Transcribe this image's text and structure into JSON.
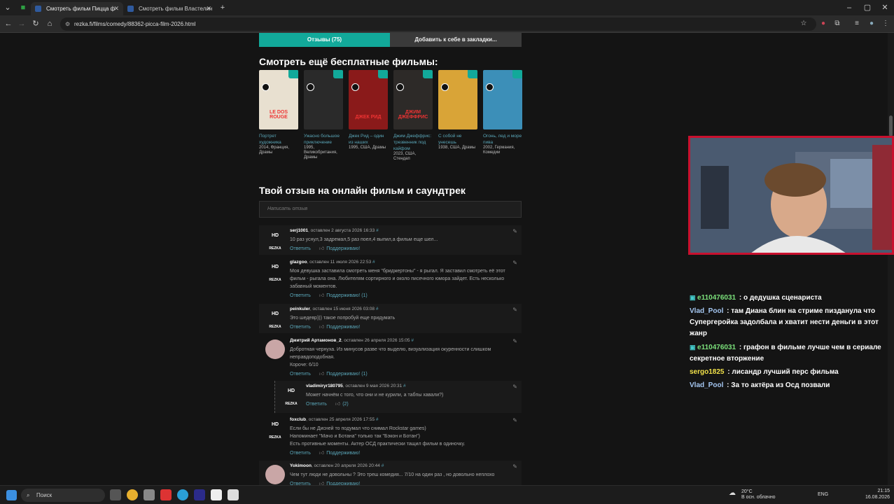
{
  "browser": {
    "tabs": [
      {
        "label": "Смотреть фильм Пицца ф"
      },
      {
        "label": "Смотреть фильм Властелин"
      }
    ],
    "url": "rezka.fi/films/comedy/88362-picca-film-2026.html"
  },
  "page": {
    "reviews_button": "Отзывы (75)",
    "bookmark_button": "Добавить к себе в закладки...",
    "more_title": "Смотреть ещё бесплатные фильмы:",
    "films": [
      {
        "title": "Портрет художника",
        "meta": "2014, Франция, Драмы",
        "poster_text": "LE DOS ROUGE",
        "color": "#e8e0d0"
      },
      {
        "title": "Ужасно большое приключение",
        "meta": "1995, Великобритания, Драмы",
        "poster_text": "",
        "color": "#2a2a2a"
      },
      {
        "title": "Джек Рид – один из наших",
        "meta": "1995, США, Драмы",
        "poster_text": "ДЖЕК РИД",
        "color": "#8a1a1a"
      },
      {
        "title": "Джим Джеффрис: трезвенник под кайфом",
        "meta": "2023, США, Стендап",
        "poster_text": "ДЖИМ ДЖЕФФРИС",
        "color": "#2d2a28"
      },
      {
        "title": "С собой не унесешь",
        "meta": "1938, США, Драмы",
        "poster_text": "",
        "color": "#d9a437"
      },
      {
        "title": "Огонь, лед и море пива",
        "meta": "2002, Германия, Комедии",
        "poster_text": "",
        "color": "#3c8fb8"
      }
    ],
    "review_title": "Твой отзыв на онлайн фильм и саундтрек",
    "comment_placeholder": "Написать отзыв",
    "comments": [
      {
        "user": "serj1001",
        "date": ", оставлен 2 августа 2026 16:33",
        "text": "10 раз уснул,3 задремал,5 раз поел,4 выпил,а фильм еще шел...",
        "reply": "Ответить",
        "like": "Поддерживаю!"
      },
      {
        "user": "glazgoo",
        "date": ", оставлен 11 июля 2026 22:53",
        "text": "Моя девушка заставила смотреть меня \"бриджертоны\" - я рыгал. Я заставил смотреть её этот фильм - рыгала она. Любителям сортирного и около писечного юмора зайдет. Есть несколько забавный моментов.",
        "reply": "Ответить",
        "like": "Поддерживаю! (1)"
      },
      {
        "user": "peinkuler",
        "date": ", оставлен 15 июня 2026 03:08",
        "text": "Это шедевр))) такое попробуй еще придумать",
        "reply": "Ответить",
        "like": "Поддерживаю!"
      },
      {
        "user": "Дмитрий Артамонов_2",
        "date": ", оставлен 26 апреля 2026 15:05",
        "text": "Добротная чернуха. Из минусов разве что выделю, визуализация окуренности слишком неправдоподобная.",
        "text2": "Короче: 6/10",
        "reply": "Ответить",
        "like": "Поддерживаю! (1)"
      },
      {
        "user": "vladimiryr180795",
        "date": ", оставлен 9 мая 2026 20:31",
        "text": "Может начнём с того, что они и не курили, а табпы хавали?)",
        "reply": "Ответить",
        "like": "(2)"
      },
      {
        "user": "foxclub",
        "date": ", оставлен 25 апреля 2026 17:55",
        "text": "Если бы не Дисней то подумал что снимал Rockstar games)",
        "text2": "Напоминает \"Мачо и Ботана\" только так \"Бэкон и Ботан\")",
        "text3": "Есть противные моменты. Актер ОСД практически тащил фильм в одиночку.",
        "reply": "Ответить",
        "like": "Поддерживаю!"
      },
      {
        "user": "Yokimoon",
        "date": ", оставлен 20 апреля 2026 20:44",
        "text": "Чем тут люди не довольны ? Это треш комедия... 7/10 на один раз , но довольно неплохо",
        "reply": "Ответить",
        "like": "Поддерживаю!"
      }
    ],
    "hd_label": "HD",
    "brand": "REZKA"
  },
  "chat": [
    {
      "user": "e110476031",
      "text": " : о дедушка сценариста",
      "color": "#7be07b",
      "badge": true
    },
    {
      "user": "Vlad_Pool",
      "text": " : там Диана блин на стриме пизданула что Супергеройка задолбала и хватит нести деньги в этот жанр",
      "color": "#a5c7f2",
      "badge": false
    },
    {
      "user": "e110476031",
      "text": " : графон в фильме лучше чем в сериале секретное вторжение",
      "color": "#7be07b",
      "badge": true
    },
    {
      "user": "sergo1825",
      "text": " : лисандр лучший перс фильма",
      "color": "#f2e24a",
      "badge": false
    },
    {
      "user": "Vlad_Pool",
      "text": " : За то актёра из Осд позвали",
      "color": "#a5c7f2",
      "badge": false
    }
  ],
  "taskbar": {
    "search": "Поиск",
    "weather_temp": "20°C",
    "weather_desc": "В осн. облачно",
    "lang": "ENG",
    "time": "21:15",
    "date": "16.08.2026"
  }
}
